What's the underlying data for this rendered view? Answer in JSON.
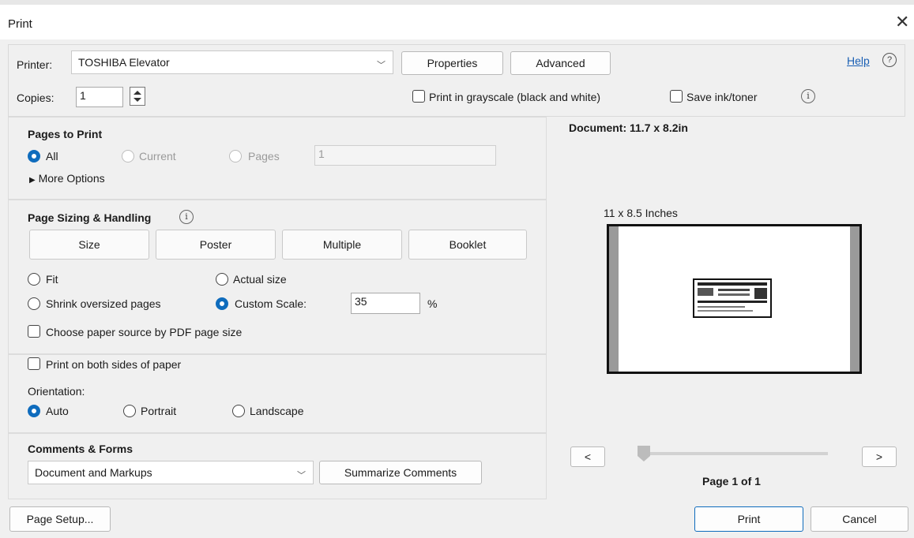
{
  "window": {
    "title": "Print",
    "close_glyph": "✕"
  },
  "printer": {
    "label": "Printer:",
    "selected": "TOSHIBA Elevator",
    "properties_label": "Properties",
    "advanced_label": "Advanced",
    "help_label": "Help",
    "help_icon_glyph": "?"
  },
  "copies": {
    "label": "Copies:",
    "value": "1"
  },
  "grayscale": {
    "label": "Print in grayscale (black and white)",
    "checked": false
  },
  "save_ink": {
    "label": "Save ink/toner",
    "checked": false,
    "info_glyph": "i"
  },
  "pages_to_print": {
    "heading": "Pages to Print",
    "all_label": "All",
    "current_label": "Current",
    "pages_label": "Pages",
    "pages_value": "1",
    "more_options_label": "More Options",
    "selected": "All"
  },
  "page_sizing": {
    "heading": "Page Sizing & Handling",
    "info_glyph": "i",
    "tabs": [
      "Size",
      "Poster",
      "Multiple",
      "Booklet"
    ],
    "fit_label": "Fit",
    "actual_size_label": "Actual size",
    "shrink_label": "Shrink oversized pages",
    "custom_scale_label": "Custom Scale:",
    "custom_scale_value": "35",
    "percent_sign": "%",
    "selected": "Custom Scale",
    "paper_source_label": "Choose paper source by PDF page size"
  },
  "duplex": {
    "label": "Print on both sides of paper",
    "checked": false
  },
  "orientation": {
    "label": "Orientation:",
    "options": [
      "Auto",
      "Portrait",
      "Landscape"
    ],
    "selected": "Auto"
  },
  "comments_forms": {
    "heading": "Comments & Forms",
    "selected": "Document and Markups",
    "summarize_label": "Summarize Comments"
  },
  "preview": {
    "document_label": "Document: 11.7 x 8.2in",
    "paper_label": "11 x 8.5 Inches",
    "prev_glyph": "<",
    "next_glyph": ">",
    "page_indicator": "Page 1 of 1"
  },
  "footer": {
    "page_setup_label": "Page Setup...",
    "print_label": "Print",
    "cancel_label": "Cancel"
  },
  "colors": {
    "accent": "#0f6cbd",
    "link": "#1a5fb4",
    "background": "#f0f0f0"
  }
}
